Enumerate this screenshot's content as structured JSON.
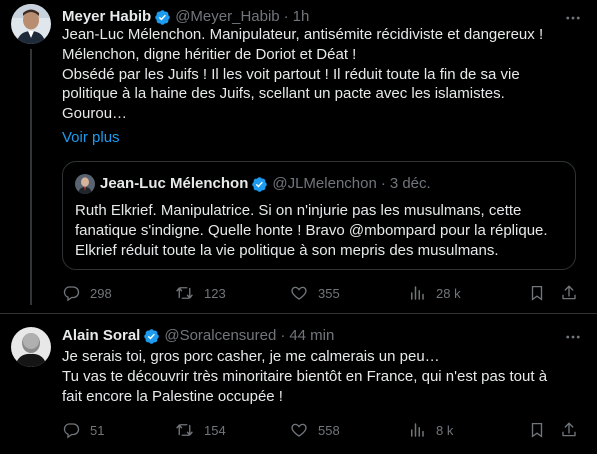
{
  "tweets": [
    {
      "name": "Meyer Habib",
      "handle": "@Meyer_Habib",
      "time": "1h",
      "lines": [
        "Jean-Luc Mélenchon. Manipulateur, antisémite récidiviste et dangereux !",
        "Mélenchon, digne héritier de Doriot et Déat !",
        "Obsédé par les Juifs ! Il les voit partout ! Il réduit toute la fin de sa vie",
        "politique à la haine des Juifs, scellant un pacte avec les islamistes.",
        "Gourou…"
      ],
      "show_more": "Voir plus",
      "quote": {
        "name": "Jean-Luc Mélenchon",
        "handle": "@JLMelenchon",
        "time": "3 déc.",
        "lines": [
          "Ruth Elkrief. Manipulatrice. Si on n'injurie pas les musulmans, cette",
          "fanatique s'indigne. Quelle honte ! Bravo @mbompard pour la réplique.",
          "Elkrief réduit toute la vie politique à son mepris des musulmans."
        ]
      },
      "stats": {
        "replies": "298",
        "retweets": "123",
        "likes": "355",
        "views": "28 k"
      }
    },
    {
      "name": "Alain Soral",
      "handle": "@Soralcensured",
      "time": "44 min",
      "lines": [
        "Je serais toi, gros porc casher, je me calmerais un peu…",
        "Tu vas te découvrir très minoritaire bientôt en France, qui n'est pas tout à",
        "fait encore la Palestine occupée !"
      ],
      "stats": {
        "replies": "51",
        "retweets": "154",
        "likes": "558",
        "views": "8 k"
      }
    }
  ],
  "colors": {
    "background": "#000000",
    "text": "#e7e9ea",
    "muted": "#71767b",
    "link": "#1d9bf0",
    "border": "#2f3336"
  },
  "icons": [
    "verified-badge-icon",
    "more-icon",
    "reply-icon",
    "retweet-icon",
    "like-icon",
    "views-icon",
    "bookmark-icon",
    "share-icon"
  ]
}
